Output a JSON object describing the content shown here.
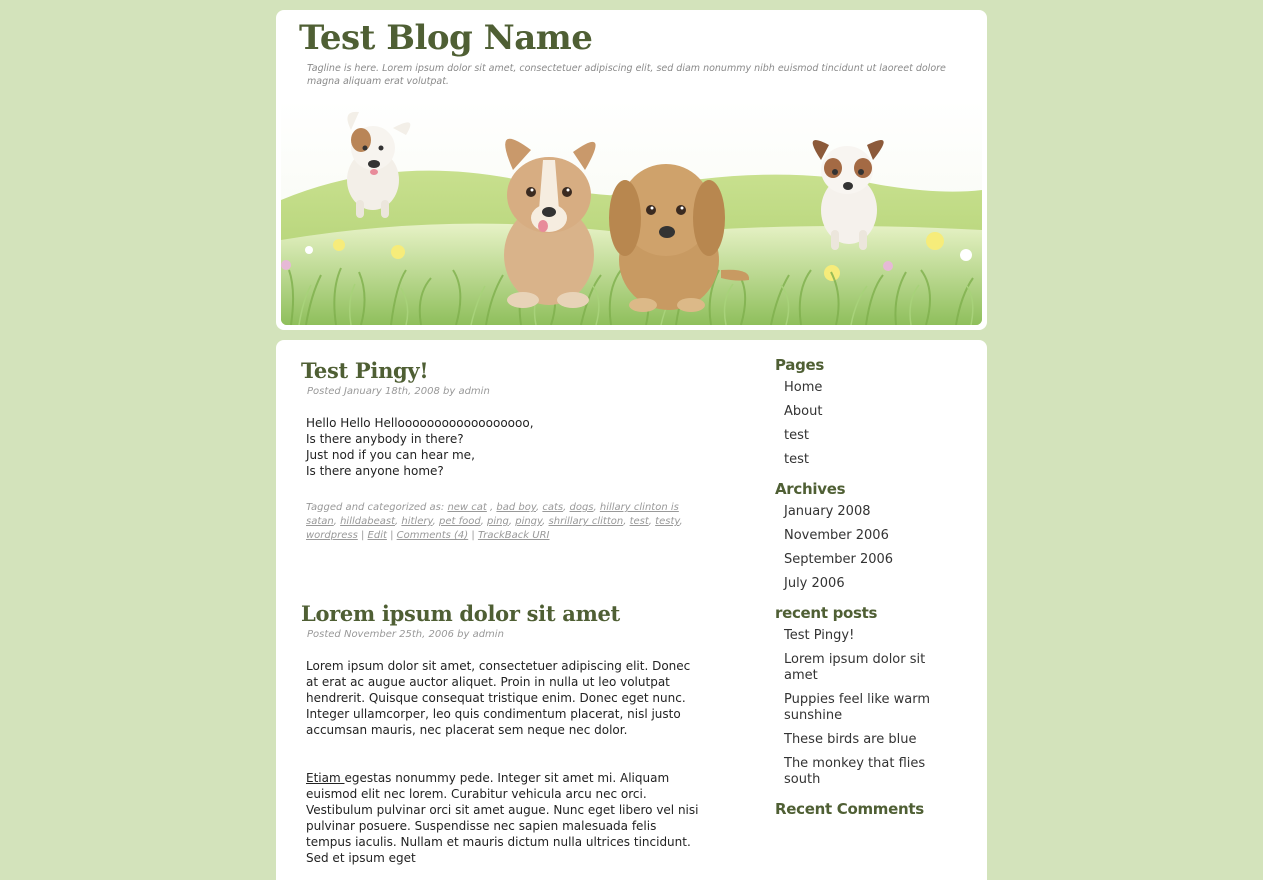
{
  "header": {
    "blog_title": "Test Blog Name",
    "tagline": "Tagline is here. Lorem ipsum dolor sit amet, consectetuer adipiscing elit, sed diam nonummy nibh euismod tincidunt ut laoreet dolore magna aliquam erat volutpat."
  },
  "posts": [
    {
      "title": "Test Pingy!",
      "meta": "Posted January 18th, 2008 by admin",
      "lines": [
        "Hello Hello Helloooooooooooooooooo,",
        "Is there anybody in there?",
        "Just nod if you can hear me,",
        "Is there anyone home?"
      ],
      "tags_prefix": "Tagged and categorized as:",
      "tags": [
        "new cat",
        "bad boy",
        "cats",
        "dogs",
        "hillary clinton is satan",
        "hilldabeast",
        "hitlery",
        "pet food",
        "ping",
        "pingy",
        "shrillary clitton",
        "test",
        "testy",
        "wordpress"
      ],
      "edit": "Edit",
      "comments": "Comments (4)",
      "trackback": "TrackBack URI"
    },
    {
      "title": "Lorem ipsum dolor sit amet",
      "meta": "Posted November 25th, 2006 by admin",
      "para1": "Lorem ipsum dolor sit amet, consectetuer adipiscing elit. Donec at erat ac augue auctor aliquet. Proin in nulla ut leo volutpat hendrerit. Quisque consequat tristique enim. Donec eget nunc. Integer ullamcorper, leo quis condimentum placerat, nisl justo accumsan mauris, nec placerat sem neque nec dolor.",
      "para2_link": "Etiam ",
      "para2": "egestas nonummy pede. Integer sit amet mi. Aliquam euismod elit nec lorem. Curabitur vehicula arcu nec orci. Vestibulum pulvinar orci sit amet augue. Nunc eget libero vel nisi pulvinar posuere. Suspendisse nec sapien malesuada felis tempus iaculis. Nullam et mauris dictum nulla ultrices tincidunt. Sed et ipsum eget"
    }
  ],
  "sidebar": {
    "pages_heading": "Pages",
    "pages": [
      "Home",
      "About",
      "test",
      "test"
    ],
    "archives_heading": "Archives",
    "archives": [
      "January 2008",
      "November 2006",
      "September 2006",
      "July 2006"
    ],
    "recent_heading": "recent posts",
    "recent": [
      "Test Pingy!",
      "Lorem ipsum dolor sit amet",
      "Puppies feel like warm sunshine",
      "These birds are blue",
      "The monkey that flies south"
    ],
    "comments_heading": "Recent Comments"
  },
  "colors": {
    "background": "#d3e3bb",
    "heading": "#4f5f34"
  }
}
